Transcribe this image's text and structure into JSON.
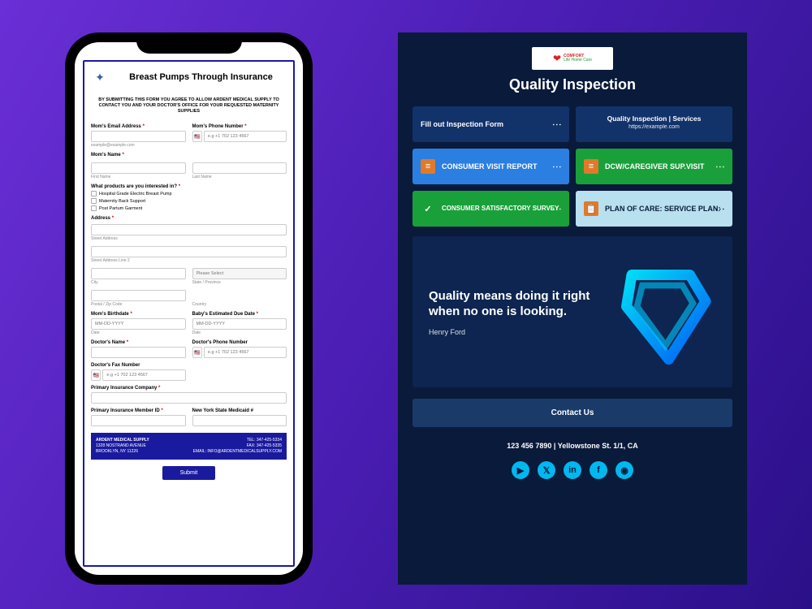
{
  "phone_form": {
    "title": "Breast Pumps Through Insurance",
    "consent": "BY SUBMITTING THIS FORM YOU AGREE TO ALLOW ARDENT MEDICAL SUPPLY TO CONTACT YOU AND YOUR DOCTOR'S OFFICE FOR YOUR REQUESTED MATERNITY SUPPLIES",
    "email_label": "Mom's Email Address",
    "email_help": "example@example.com",
    "phone_label": "Mom's Phone Number",
    "phone_placeholder": "e.g +1 702 123 4567",
    "name_label": "Mom's Name",
    "first_help": "First Name",
    "last_help": "Last Name",
    "products_label": "What products are you interested in?",
    "products": [
      "Hospital Grade Electric Breast Pump",
      "Maternity Back Support",
      "Post Partum Garment"
    ],
    "address_label": "Address",
    "street_help": "Street Address",
    "street2_help": "Street Address Line 2",
    "city_help": "City",
    "state_help": "State / Province",
    "state_placeholder": "Please Select",
    "zip_help": "Postal / Zip Code",
    "country_help": "Country",
    "birthdate_label": "Mom's Birthdate",
    "duedate_label": "Baby's Estimated Due Date",
    "date_placeholder": "MM-DD-YYYY",
    "date_help": "Date",
    "doctor_name_label": "Doctor's Name",
    "doctor_phone_label": "Doctor's Phone Number",
    "doctor_fax_label": "Doctor's Fax Number",
    "primary_ins_label": "Primary Insurance Company",
    "primary_member_label": "Primary Insurance Member ID",
    "medicaid_label": "New York State Medicaid #",
    "footer_left": [
      "ARDENT MEDICAL SUPPLY",
      "1328 NOSTRAND AVENUE",
      "BROOKLYN, NY 11226"
    ],
    "footer_right": [
      "TEL: 347-425-5334",
      "FAX: 347-425-5335",
      "EMAIL: INFO@ARDENTMEDICALSUPPLY.COM"
    ],
    "submit": "Submit"
  },
  "panel": {
    "brand_main": "COMFORT",
    "brand_sub": "Life Home Care",
    "title": "Quality Inspection",
    "header_left": "Fill out Inspection Form",
    "header_right_title": "Quality Inspection | Services",
    "header_right_sub": "https://example.com",
    "tiles": [
      {
        "label": "CONSUMER VISIT REPORT",
        "bg": "#2a7fe0",
        "icon": "doc",
        "icon_bg": "#e07a2a"
      },
      {
        "label": "DCW/CAREGIVER SUP.VISIT",
        "bg": "#1aa03a",
        "icon": "doc",
        "icon_bg": "#e07a2a"
      },
      {
        "label": "CONSUMER SATISFACTORY SURVEY",
        "bg": "#1aa03a",
        "icon": "check",
        "icon_bg": "transparent"
      },
      {
        "label": "PLAN OF CARE: SERVICE PLAN:",
        "bg": "#b8e0ef",
        "icon": "clip",
        "icon_bg": "#e07a2a",
        "dark": true
      }
    ],
    "quote": "Quality means doing it right when no one is looking.",
    "author": "Henry Ford",
    "contact_btn": "Contact Us",
    "contact_info": "123 456 7890 | Yellowstone St. 1/1, CA"
  }
}
